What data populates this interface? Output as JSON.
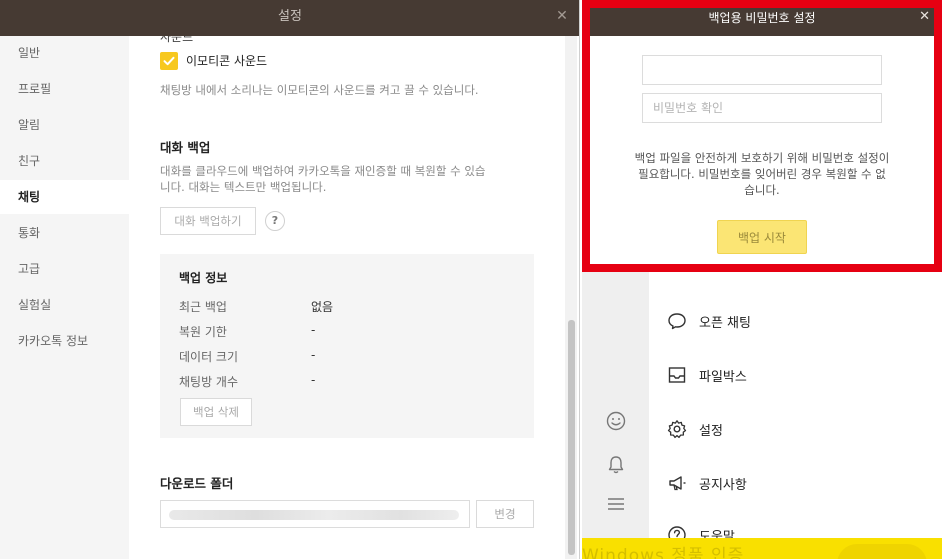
{
  "settings": {
    "title": "설정",
    "close_glyph": "✕",
    "sidebar": {
      "items": [
        {
          "label": "일반"
        },
        {
          "label": "프로필"
        },
        {
          "label": "알림"
        },
        {
          "label": "친구"
        },
        {
          "label": "채팅",
          "active": true
        },
        {
          "label": "통화"
        },
        {
          "label": "고급"
        },
        {
          "label": "실험실"
        },
        {
          "label": "카카오톡 정보"
        }
      ]
    },
    "content": {
      "clipped_heading": "사운드",
      "emoticon_sound_label": "이모티콘 사운드",
      "emoticon_sound_checked": true,
      "emoticon_sound_desc": "채팅방 내에서 소리나는 이모티콘의 사운드를 켜고 끌 수 있습니다.",
      "backup_title": "대화 백업",
      "backup_desc_1": "대화를 클라우드에 백업하여 카카오톡을 재인증할 때 복원할 수 있습",
      "backup_desc_2": "니다. 대화는 텍스트만 백업됩니다.",
      "backup_button": "대화 백업하기",
      "help_glyph": "?",
      "backup_info": {
        "title": "백업 정보",
        "rows": [
          {
            "label": "최근 백업",
            "value": "없음"
          },
          {
            "label": "복원 기한",
            "value": "-"
          },
          {
            "label": "데이터 크기",
            "value": "-"
          },
          {
            "label": "채팅방 개수",
            "value": "-"
          }
        ],
        "delete_button": "백업 삭제"
      },
      "download_title": "다운로드 폴더",
      "change_button": "변경"
    }
  },
  "kakao": {
    "menu": [
      {
        "label": "오픈 채팅",
        "icon": "open-chat-icon"
      },
      {
        "label": "파일박스",
        "icon": "filebox-icon"
      },
      {
        "label": "설정",
        "icon": "gear-icon"
      },
      {
        "label": "공지사항",
        "icon": "megaphone-icon"
      },
      {
        "label": "도움말",
        "icon": "help-circle-icon"
      }
    ],
    "rail_icons": [
      "emoticon-icon",
      "bell-icon",
      "hamburger-menu-icon"
    ],
    "watermark": "Windows 정품 인증"
  },
  "dialog": {
    "title": "백업용 비밀번호 설정",
    "close_glyph": "✕",
    "password_value": "",
    "password_placeholder": "",
    "confirm_placeholder": "비밀번호 확인",
    "message_1": "백업 파일을 안전하게 보호하기 위해 비밀번호 설정이",
    "message_2": "필요합니다. 비밀번호를 잊어버린 경우 복원할 수 없",
    "message_3": "습니다.",
    "start_button": "백업 시작",
    "highlight_color": "#e60012"
  },
  "colors": {
    "titlebar": "#463a33",
    "accent_yellow": "#f7c81f",
    "kakao_yellow": "#f9e000"
  }
}
